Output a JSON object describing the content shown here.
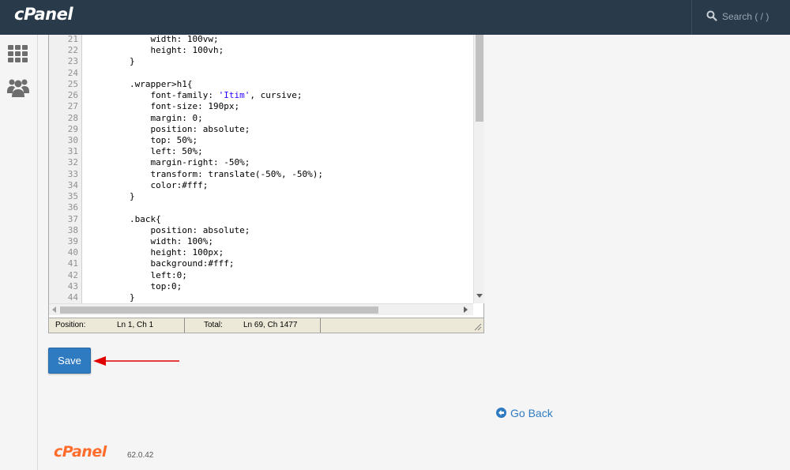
{
  "header": {
    "logo": "cPanel",
    "search_placeholder": "Search ( / )",
    "search_icon": "search-icon"
  },
  "sidebar": {
    "items": [
      {
        "name": "apps-grid-icon"
      },
      {
        "name": "users-icon"
      }
    ]
  },
  "editor": {
    "lines": [
      {
        "num": "21",
        "indent": "\t\t\t",
        "code": "width: 100vw;"
      },
      {
        "num": "22",
        "indent": "\t\t\t",
        "code": "height: 100vh;"
      },
      {
        "num": "23",
        "indent": "\t\t",
        "code": "}"
      },
      {
        "num": "24",
        "indent": "",
        "code": ""
      },
      {
        "num": "25",
        "indent": "\t\t",
        "code": ".wrapper>h1{"
      },
      {
        "num": "26",
        "indent": "\t\t\t",
        "code": "font-family: ",
        "str": "'Itim'",
        "after": ", cursive;"
      },
      {
        "num": "27",
        "indent": "\t\t\t",
        "code": "font-size: 190px;"
      },
      {
        "num": "28",
        "indent": "\t\t\t",
        "code": "margin: 0;"
      },
      {
        "num": "29",
        "indent": "\t\t    ",
        "code": "position: absolute;"
      },
      {
        "num": "30",
        "indent": "\t\t    ",
        "code": "top: 50%;"
      },
      {
        "num": "31",
        "indent": "\t\t    ",
        "code": "left: 50%;"
      },
      {
        "num": "32",
        "indent": "\t\t    ",
        "code": "margin-right: -50%;"
      },
      {
        "num": "33",
        "indent": "\t\t    ",
        "code": "transform: translate(-50%, -50%);"
      },
      {
        "num": "34",
        "indent": "\t\t    ",
        "code": "color:#fff;"
      },
      {
        "num": "35",
        "indent": "\t\t",
        "code": "}"
      },
      {
        "num": "36",
        "indent": "",
        "code": ""
      },
      {
        "num": "37",
        "indent": "\t\t",
        "code": ".back{"
      },
      {
        "num": "38",
        "indent": "\t\t\t",
        "code": "position: absolute;"
      },
      {
        "num": "39",
        "indent": "\t\t\t",
        "code": "width: 100%;"
      },
      {
        "num": "40",
        "indent": "\t\t\t",
        "code": "height: 100px;"
      },
      {
        "num": "41",
        "indent": "\t\t\t",
        "code": "background:#fff;"
      },
      {
        "num": "42",
        "indent": "\t\t\t",
        "code": "left:0;"
      },
      {
        "num": "43",
        "indent": "\t\t\t",
        "code": "top:0;"
      },
      {
        "num": "44",
        "indent": "\t\t",
        "code": "}"
      }
    ],
    "status": {
      "position_label": "Position:",
      "position_value": "Ln 1, Ch 1",
      "total_label": "Total:",
      "total_value": "Ln 69, Ch 1477"
    }
  },
  "actions": {
    "save_label": "Save",
    "go_back_label": "Go Back"
  },
  "footer": {
    "logo": "cPanel",
    "version": "62.0.42"
  },
  "colors": {
    "topbar": "#293a4a",
    "accent": "#2f7bc2",
    "brand_orange": "#ff6c2c",
    "arrow": "#e00000"
  }
}
